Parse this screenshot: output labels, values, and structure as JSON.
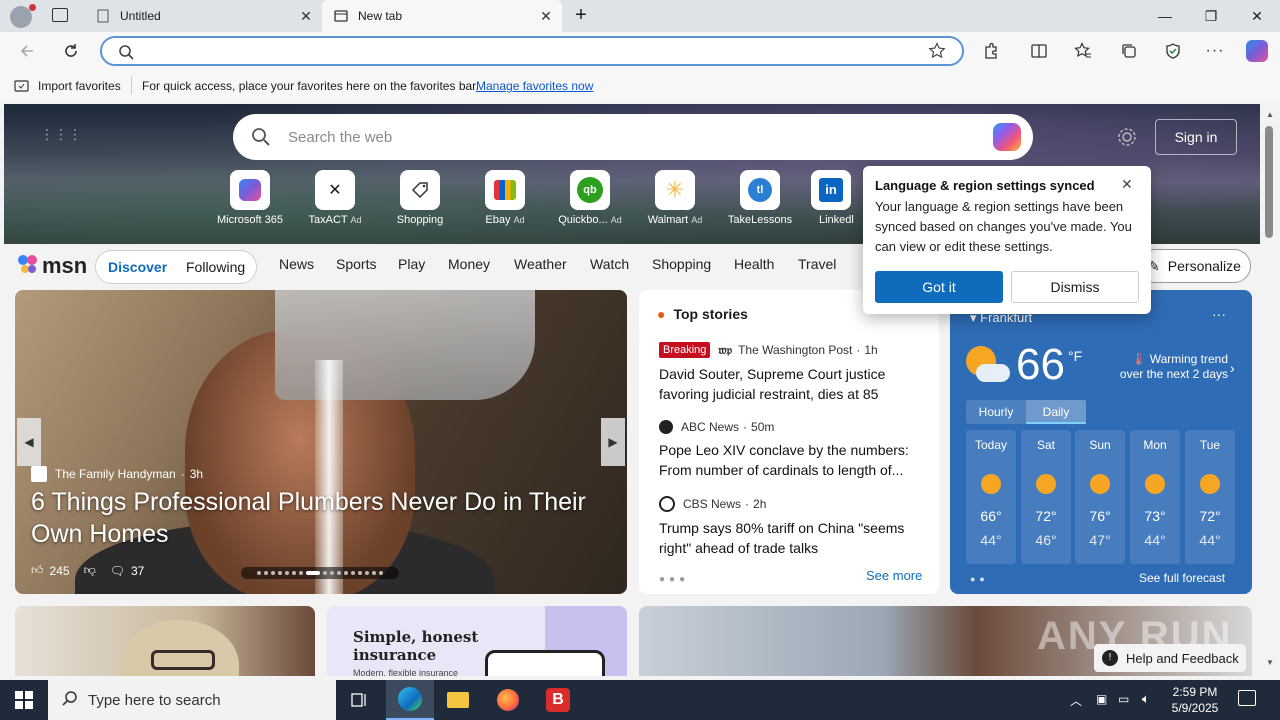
{
  "browser": {
    "tabs": [
      {
        "title": "Untitled",
        "active": false
      },
      {
        "title": "New tab",
        "active": true
      }
    ],
    "address_value": "",
    "favorites_bar": {
      "import_label": "Import favorites",
      "message": "For quick access, place your favorites here on the favorites bar.",
      "manage_link": "Manage favorites now"
    }
  },
  "newtab": {
    "search_placeholder": "Search the web",
    "sign_in": "Sign in",
    "quick_links": [
      {
        "label": "Microsoft 365",
        "ad": "",
        "icon": "microsoft-365-icon",
        "color": "#7b5cd6"
      },
      {
        "label": "TaxACT",
        "ad": "Ad",
        "icon": "taxact-icon",
        "color": "#1a1a1a"
      },
      {
        "label": "Shopping",
        "ad": "",
        "icon": "shopping-tag-icon",
        "color": "#333333"
      },
      {
        "label": "Ebay",
        "ad": "Ad",
        "icon": "ebay-icon",
        "color": "#e53238"
      },
      {
        "label": "Quickbo...",
        "ad": "Ad",
        "icon": "quickbooks-icon",
        "color": "#2ca01c"
      },
      {
        "label": "Walmart",
        "ad": "Ad",
        "icon": "walmart-icon",
        "color": "#0071ce"
      },
      {
        "label": "TakeLessons",
        "ad": "",
        "icon": "takelessons-icon",
        "color": "#2a7fd4"
      },
      {
        "label": "Linkedl",
        "ad": "",
        "icon": "linkedin-icon",
        "color": "#0a66c2"
      }
    ]
  },
  "msn": {
    "logo": "msn",
    "pill_tabs": [
      "Discover",
      "Following"
    ],
    "nav": [
      "News",
      "Sports",
      "Play",
      "Money",
      "Weather",
      "Watch",
      "Shopping",
      "Health",
      "Travel"
    ],
    "personalize": "Personalize"
  },
  "main_story": {
    "source": "The Family Handyman",
    "age": "3h",
    "title": "6 Things Professional Plumbers Never Do in Their Own Homes",
    "likes": "245",
    "comments": "37"
  },
  "top_stories": {
    "heading": "Top stories",
    "stories": [
      {
        "badge": "Breaking",
        "source": "The Washington Post",
        "age": "1h",
        "headline": "David Souter, Supreme Court justice favoring judicial restraint, dies at 85"
      },
      {
        "badge": "",
        "source": "ABC News",
        "age": "50m",
        "headline": "Pope Leo XIV conclave by the numbers: From number of cardinals to length of..."
      },
      {
        "badge": "",
        "source": "CBS News",
        "age": "2h",
        "headline": "Trump says 80% tariff on China \"seems right\" ahead of trade talks"
      }
    ],
    "see_more": "See more"
  },
  "weather": {
    "location": "Frankfurt",
    "temp": "66",
    "unit": "°F",
    "trend": "Warming trend over the next 2 days",
    "tabs": [
      "Hourly",
      "Daily"
    ],
    "days": [
      {
        "day": "Today",
        "high": "66°",
        "low": "44°"
      },
      {
        "day": "Sat",
        "high": "72°",
        "low": "46°"
      },
      {
        "day": "Sun",
        "high": "76°",
        "low": "47°"
      },
      {
        "day": "Mon",
        "high": "73°",
        "low": "44°"
      },
      {
        "day": "Tue",
        "high": "72°",
        "low": "44°"
      }
    ],
    "see_full": "See full forecast"
  },
  "popup": {
    "title": "Language & region settings synced",
    "body": "Your language & region settings have been synced based on changes you've made. You can view or edit these settings.",
    "primary": "Got it",
    "secondary": "Dismiss"
  },
  "bottom": {
    "insurance_title": "Simple, honest insurance",
    "insurance_sub": "Modern, flexible insurance",
    "help": "Help and Feedback",
    "watermark": "ANY RUN"
  },
  "taskbar": {
    "search_placeholder": "Type here to search",
    "time": "2:59 PM",
    "date": "5/9/2025"
  },
  "colors": {
    "accent": "#0f6cbd",
    "weather_bg": "#2e6cb5",
    "breaking": "#c50f1f"
  }
}
